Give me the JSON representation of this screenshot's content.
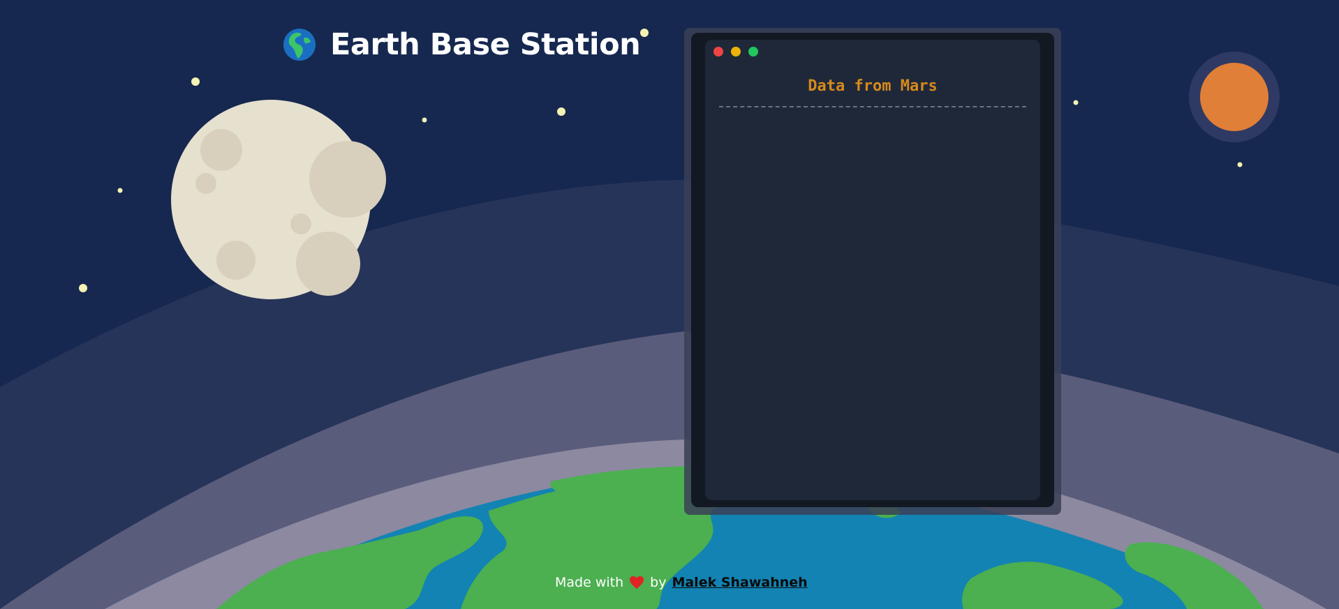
{
  "header": {
    "title": "Earth Base Station",
    "icon": "globe-icon"
  },
  "terminal": {
    "title": "Data from Mars",
    "controls": [
      "close",
      "minimize",
      "maximize"
    ],
    "lines": []
  },
  "footer": {
    "prefix": "Made with",
    "heart_icon": "heart-icon",
    "by": "by",
    "author": "Malek Shawahneh"
  },
  "colors": {
    "sky": "#16284f",
    "moon": "#e6e0cf",
    "mars": "#e07f37",
    "ocean": "#1283b3",
    "land": "#4caf50",
    "terminal_heading": "#d68a1c",
    "heart": "#e02424"
  }
}
